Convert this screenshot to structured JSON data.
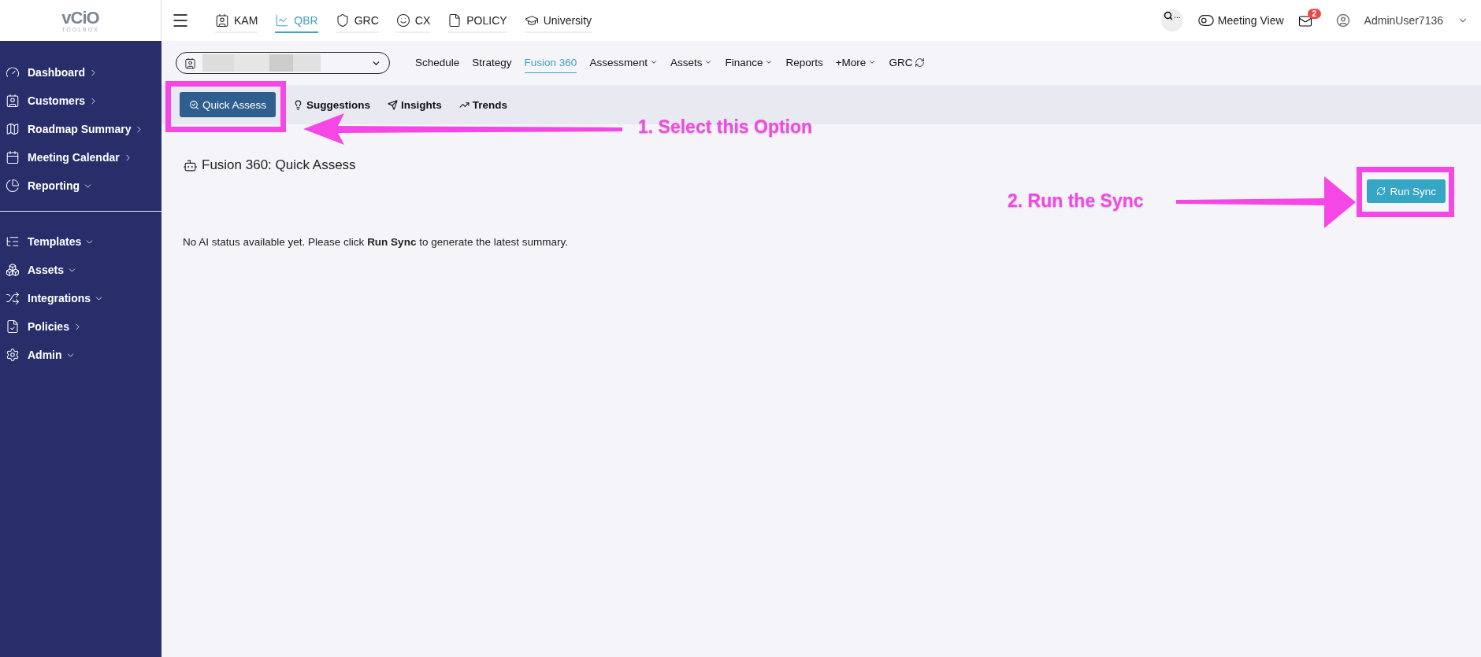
{
  "logo": {
    "mark": "vCiO",
    "subtext": "TOOLBOX"
  },
  "top_nav": [
    {
      "label": "KAM",
      "selected": false
    },
    {
      "label": "QBR",
      "selected": true
    },
    {
      "label": "GRC",
      "selected": false
    },
    {
      "label": "CX",
      "selected": false
    },
    {
      "label": "POLICY",
      "selected": false
    },
    {
      "label": "University",
      "selected": false
    }
  ],
  "header_right": {
    "search_hint": "...",
    "meeting_view": {
      "label": "Meeting View",
      "on": false
    },
    "mail_badge": "2",
    "user": "AdminUser7136"
  },
  "sidebar": {
    "groups": [
      [
        {
          "label": "Dashboard",
          "expanded": false
        },
        {
          "label": "Customers",
          "expanded": false
        },
        {
          "label": "Roadmap Summary",
          "expanded": false
        },
        {
          "label": "Meeting Calendar",
          "expanded": false
        },
        {
          "label": "Reporting",
          "expanded": true
        }
      ],
      [
        {
          "label": "Templates",
          "expanded": true
        },
        {
          "label": "Assets",
          "expanded": true
        },
        {
          "label": "Integrations",
          "expanded": true
        },
        {
          "label": "Policies",
          "expanded": false
        },
        {
          "label": "Admin",
          "expanded": true
        }
      ]
    ]
  },
  "module_tabs": [
    {
      "label": "Schedule",
      "selected": false,
      "dropdown": false
    },
    {
      "label": "Strategy",
      "selected": false,
      "dropdown": false
    },
    {
      "label": "Fusion 360",
      "selected": true,
      "dropdown": false
    },
    {
      "label": "Assessment",
      "selected": false,
      "dropdown": true
    },
    {
      "label": "Assets",
      "selected": false,
      "dropdown": true
    },
    {
      "label": "Finance",
      "selected": false,
      "dropdown": true
    },
    {
      "label": "Reports",
      "selected": false,
      "dropdown": false
    },
    {
      "label": "+More",
      "selected": false,
      "dropdown": true
    },
    {
      "label": "GRC",
      "selected": false,
      "dropdown": false,
      "refresh": true
    }
  ],
  "sub_tabs": [
    {
      "label": "Quick Assess",
      "selected": true
    },
    {
      "label": "Suggestions",
      "selected": false
    },
    {
      "label": "Insights",
      "selected": false
    },
    {
      "label": "Trends",
      "selected": false
    }
  ],
  "panel": {
    "title": "Fusion 360: Quick Assess",
    "run_sync_button": "Run Sync",
    "message": "No AI status available yet. Please click **Run Sync** to generate the latest summary."
  },
  "annotations": [
    {
      "text": "1. Select this Option"
    },
    {
      "text": "2. Run the Sync"
    }
  ]
}
